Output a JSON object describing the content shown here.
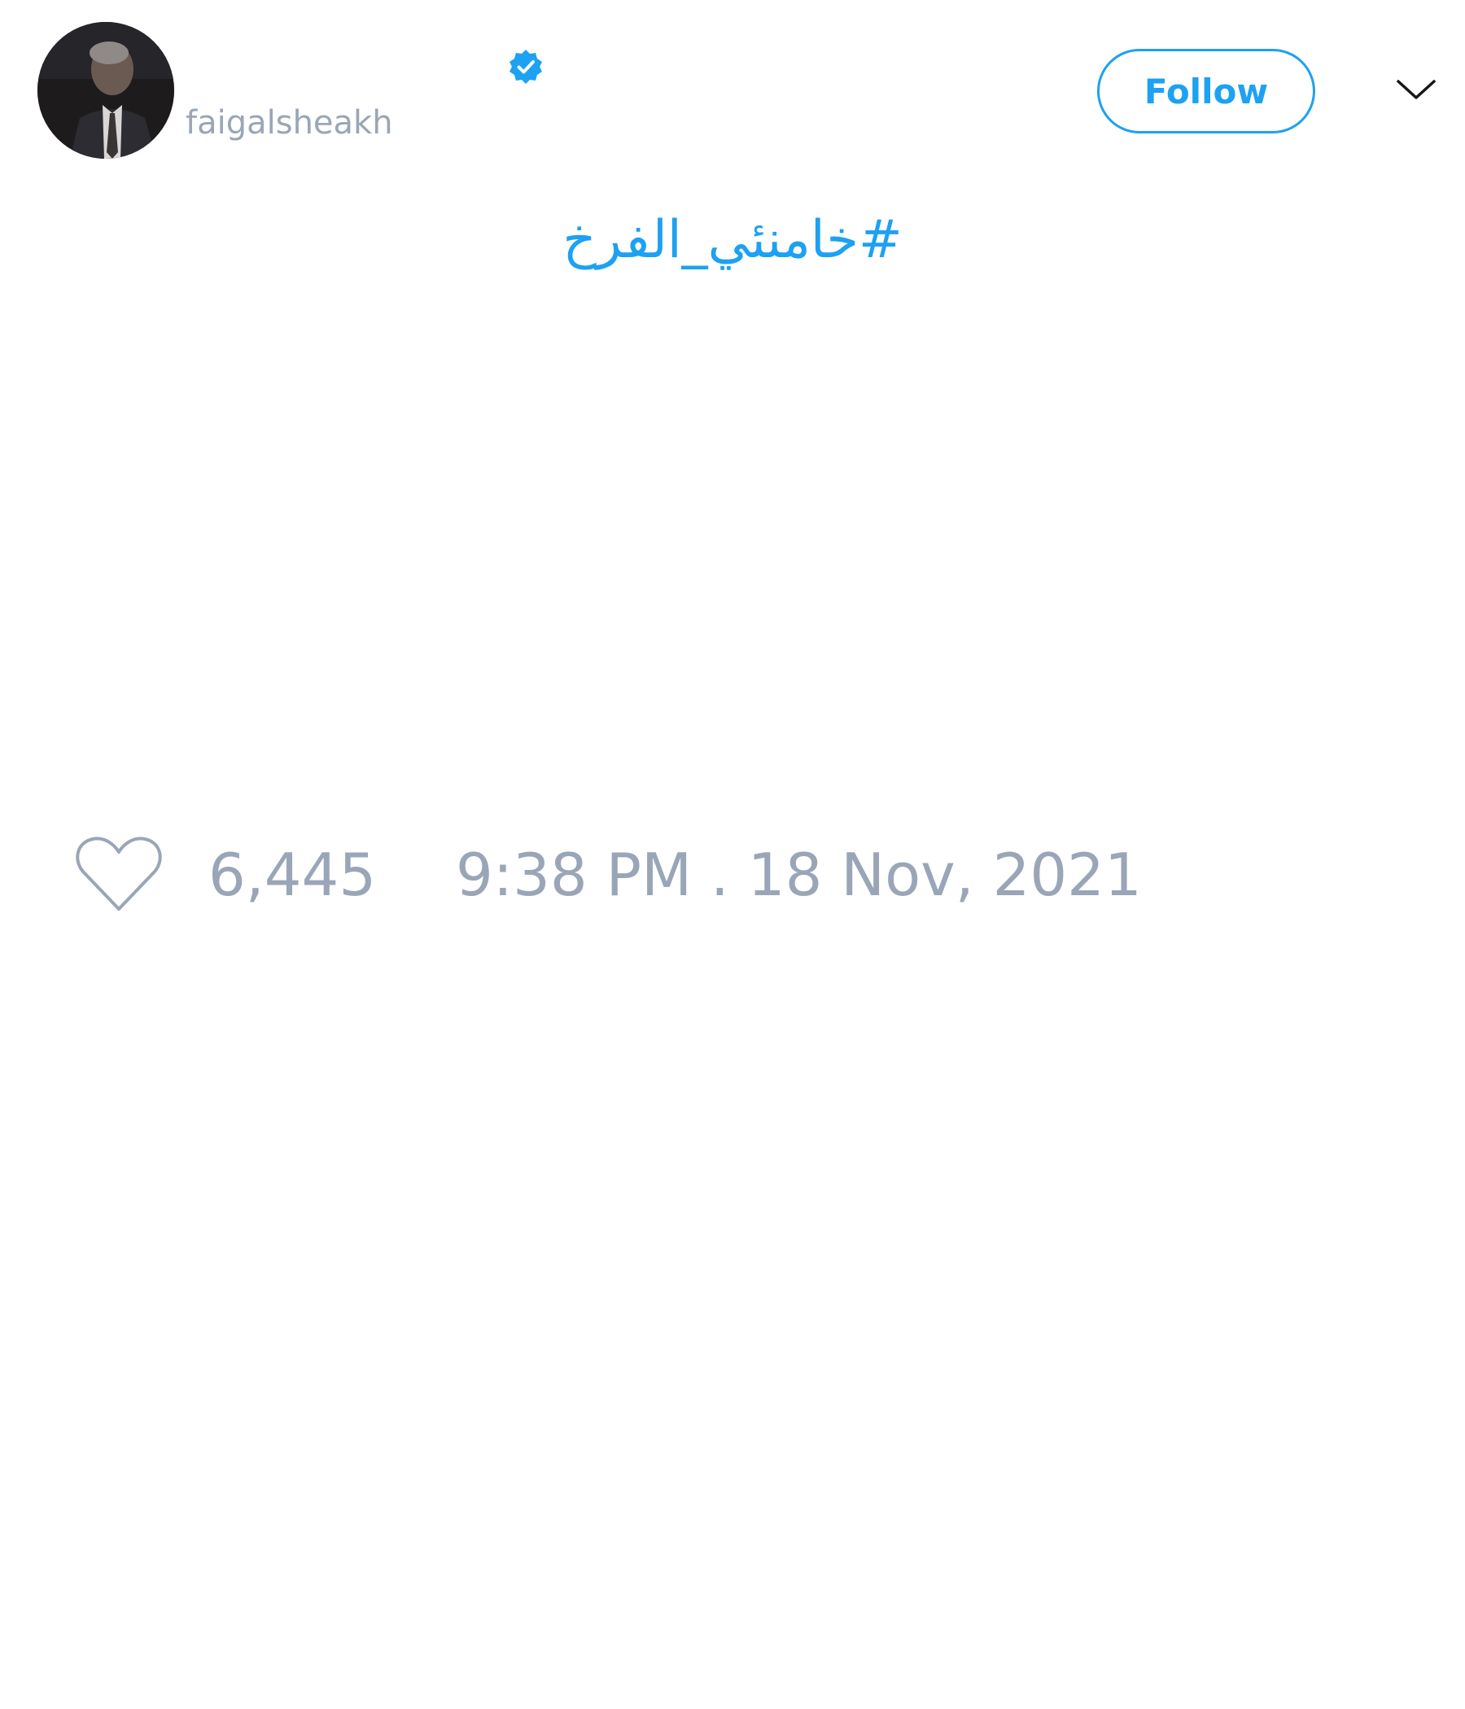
{
  "tweet": {
    "author": {
      "display_name": "",
      "username": "faigalsheakh",
      "verified": true,
      "avatar_icon": "person-photo"
    },
    "follow_label": "Follow",
    "menu_icon": "chevron-down-icon",
    "text": "#خامنئي_الفرخ",
    "like_icon": "heart-outline-icon",
    "like_count": "6,445",
    "timestamp": "9:38 PM . 18 Nov, 2021"
  },
  "colors": {
    "accent": "#1da1f2",
    "muted": "#9aa6b7",
    "background": "#ffffff"
  }
}
